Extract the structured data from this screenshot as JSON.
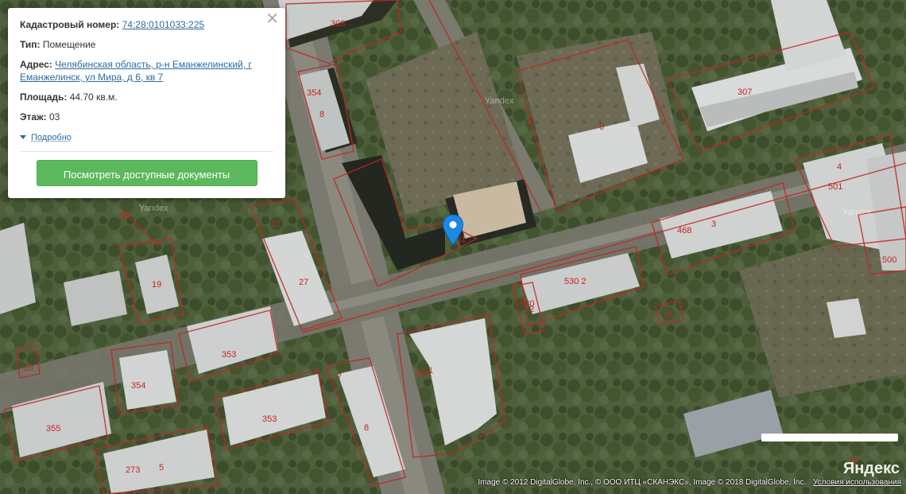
{
  "popup": {
    "cadastral_label": "Кадастровый номер:",
    "cadastral_value": "74:28:0101033:225",
    "type_label": "Тип:",
    "type_value": "Помещение",
    "address_label": "Адрес:",
    "address_value": "Челябинская область, р-н Еманжелинский, г Еманжелинск, ул Мира, д 6, кв 7",
    "area_label": "Площадь:",
    "area_value": "44.70 кв.м.",
    "floor_label": "Этаж:",
    "floor_value": "03",
    "more_label": "Подробно",
    "docs_button": "Посмотреть доступные документы",
    "close_icon": "close-icon"
  },
  "map": {
    "lot_labels": [
      "308",
      "354",
      "8",
      "6",
      "6",
      "307",
      "4",
      "501",
      "500",
      "18",
      "17",
      "19",
      "27",
      "468",
      "3",
      "51",
      "530 2",
      "530",
      "2",
      "34",
      "353",
      "28",
      "354",
      "353",
      "355",
      "273",
      "5",
      "7",
      "8",
      "469",
      "1",
      "19"
    ],
    "watermarks": [
      "Yandex",
      "Yandex",
      "Yandex"
    ],
    "marker_icon": "map-pin-icon",
    "parcel_color": "#c22525",
    "logo_text": "Яндекс"
  },
  "footer": {
    "copyright": "Image © 2012 DigitalGlobe, Inc., © ООО ИТЦ «СКАНЭКС», Image © 2018 DigitalGlobe, Inc.",
    "terms_link": "Условия использования"
  }
}
